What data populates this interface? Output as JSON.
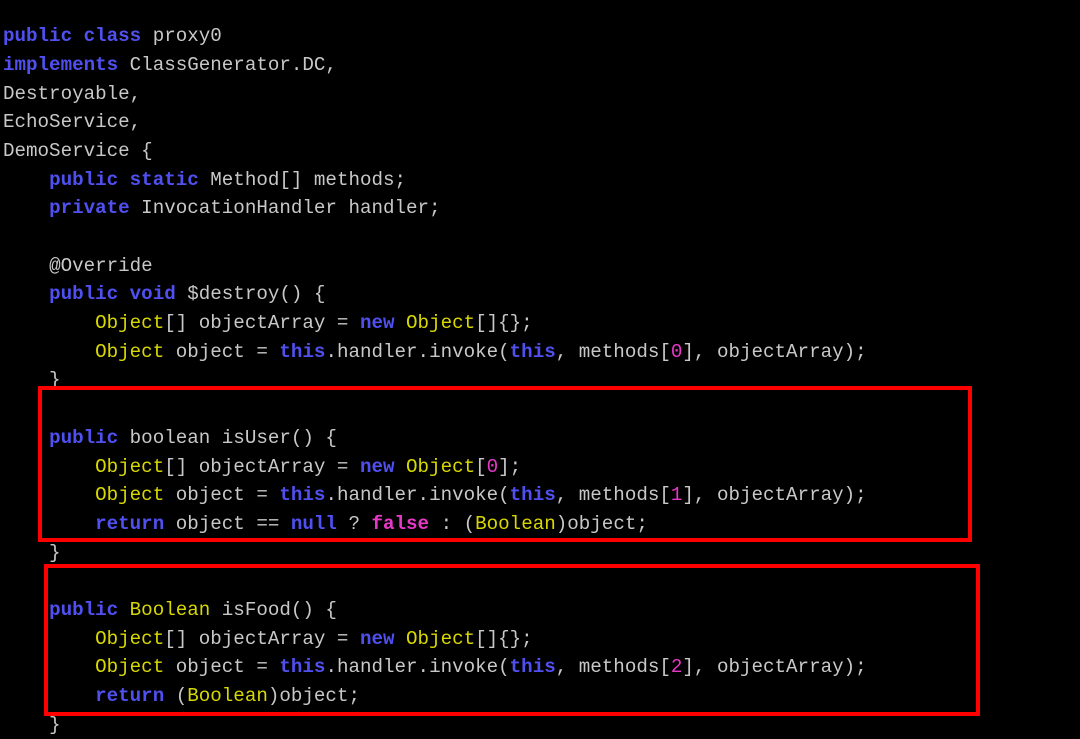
{
  "editor": {
    "language": "java",
    "background_color": "#000000",
    "default_text_color": "#c8c8c8",
    "syntax_colors": {
      "keyword": "#5050f0",
      "type": "#d8d800",
      "annotation": "#00a0a0",
      "primitive": "#44e8e8",
      "literal": "#e838c8",
      "number": "#e838c8",
      "plain": "#c8c8c8"
    }
  },
  "annotations": {
    "highlight_color": "#ff0000",
    "boxes": [
      {
        "name": "isUser-method-highlight",
        "target": "isUser"
      },
      {
        "name": "isFood-method-highlight",
        "target": "isFood"
      }
    ]
  },
  "code": {
    "lines": [
      [
        {
          "t": "public",
          "c": "keyword"
        },
        {
          "t": " ",
          "c": "plain"
        },
        {
          "t": "class",
          "c": "keyword"
        },
        {
          "t": " proxy0",
          "c": "plain"
        }
      ],
      [
        {
          "t": "implements",
          "c": "keyword"
        },
        {
          "t": " ClassGenerator.DC,",
          "c": "plain"
        }
      ],
      [
        {
          "t": "Destroyable,",
          "c": "plain"
        }
      ],
      [
        {
          "t": "EchoService,",
          "c": "plain"
        }
      ],
      [
        {
          "t": "DemoService {",
          "c": "plain"
        }
      ],
      [
        {
          "t": "    ",
          "c": "plain"
        },
        {
          "t": "public",
          "c": "keyword"
        },
        {
          "t": " ",
          "c": "plain"
        },
        {
          "t": "static",
          "c": "keyword"
        },
        {
          "t": " Method[] methods;",
          "c": "plain"
        }
      ],
      [
        {
          "t": "    ",
          "c": "plain"
        },
        {
          "t": "private",
          "c": "keyword"
        },
        {
          "t": " InvocationHandler handler;",
          "c": "plain"
        }
      ],
      [
        {
          "t": "",
          "c": "plain"
        }
      ],
      [
        {
          "t": "    ",
          "c": "plain"
        },
        {
          "t": "@Override",
          "c": "annotation"
        }
      ],
      [
        {
          "t": "    ",
          "c": "plain"
        },
        {
          "t": "public",
          "c": "keyword"
        },
        {
          "t": " ",
          "c": "plain"
        },
        {
          "t": "void",
          "c": "keyword"
        },
        {
          "t": " $destroy() {",
          "c": "plain"
        }
      ],
      [
        {
          "t": "        ",
          "c": "plain"
        },
        {
          "t": "Object",
          "c": "type"
        },
        {
          "t": "[] objectArray = ",
          "c": "plain"
        },
        {
          "t": "new",
          "c": "keyword"
        },
        {
          "t": " ",
          "c": "plain"
        },
        {
          "t": "Object",
          "c": "type"
        },
        {
          "t": "[]{};",
          "c": "plain"
        }
      ],
      [
        {
          "t": "        ",
          "c": "plain"
        },
        {
          "t": "Object",
          "c": "type"
        },
        {
          "t": " object = ",
          "c": "plain"
        },
        {
          "t": "this",
          "c": "keyword"
        },
        {
          "t": ".handler.invoke(",
          "c": "plain"
        },
        {
          "t": "this",
          "c": "keyword"
        },
        {
          "t": ", methods[",
          "c": "plain"
        },
        {
          "t": "0",
          "c": "number"
        },
        {
          "t": "], objectArray);",
          "c": "plain"
        }
      ],
      [
        {
          "t": "    }",
          "c": "plain"
        }
      ],
      [
        {
          "t": "",
          "c": "plain"
        }
      ],
      [
        {
          "t": "    ",
          "c": "plain"
        },
        {
          "t": "public",
          "c": "keyword"
        },
        {
          "t": " ",
          "c": "plain"
        },
        {
          "t": "boolean",
          "c": "primitive"
        },
        {
          "t": " isUser() {",
          "c": "plain"
        }
      ],
      [
        {
          "t": "        ",
          "c": "plain"
        },
        {
          "t": "Object",
          "c": "type"
        },
        {
          "t": "[] objectArray = ",
          "c": "plain"
        },
        {
          "t": "new",
          "c": "keyword"
        },
        {
          "t": " ",
          "c": "plain"
        },
        {
          "t": "Object",
          "c": "type"
        },
        {
          "t": "[",
          "c": "plain"
        },
        {
          "t": "0",
          "c": "number"
        },
        {
          "t": "];",
          "c": "plain"
        }
      ],
      [
        {
          "t": "        ",
          "c": "plain"
        },
        {
          "t": "Object",
          "c": "type"
        },
        {
          "t": " object = ",
          "c": "plain"
        },
        {
          "t": "this",
          "c": "keyword"
        },
        {
          "t": ".handler.invoke(",
          "c": "plain"
        },
        {
          "t": "this",
          "c": "keyword"
        },
        {
          "t": ", methods[",
          "c": "plain"
        },
        {
          "t": "1",
          "c": "number"
        },
        {
          "t": "], objectArray);",
          "c": "plain"
        }
      ],
      [
        {
          "t": "        ",
          "c": "plain"
        },
        {
          "t": "return",
          "c": "keyword"
        },
        {
          "t": " object == ",
          "c": "plain"
        },
        {
          "t": "null",
          "c": "keyword"
        },
        {
          "t": " ? ",
          "c": "plain"
        },
        {
          "t": "false",
          "c": "literal"
        },
        {
          "t": " : (",
          "c": "plain"
        },
        {
          "t": "Boolean",
          "c": "type"
        },
        {
          "t": ")object;",
          "c": "plain"
        }
      ],
      [
        {
          "t": "    }",
          "c": "plain"
        }
      ],
      [
        {
          "t": "",
          "c": "plain"
        }
      ],
      [
        {
          "t": "    ",
          "c": "plain"
        },
        {
          "t": "public",
          "c": "keyword"
        },
        {
          "t": " ",
          "c": "plain"
        },
        {
          "t": "Boolean",
          "c": "type"
        },
        {
          "t": " isFood() {",
          "c": "plain"
        }
      ],
      [
        {
          "t": "        ",
          "c": "plain"
        },
        {
          "t": "Object",
          "c": "type"
        },
        {
          "t": "[] objectArray = ",
          "c": "plain"
        },
        {
          "t": "new",
          "c": "keyword"
        },
        {
          "t": " ",
          "c": "plain"
        },
        {
          "t": "Object",
          "c": "type"
        },
        {
          "t": "[]{};",
          "c": "plain"
        }
      ],
      [
        {
          "t": "        ",
          "c": "plain"
        },
        {
          "t": "Object",
          "c": "type"
        },
        {
          "t": " object = ",
          "c": "plain"
        },
        {
          "t": "this",
          "c": "keyword"
        },
        {
          "t": ".handler.invoke(",
          "c": "plain"
        },
        {
          "t": "this",
          "c": "keyword"
        },
        {
          "t": ", methods[",
          "c": "plain"
        },
        {
          "t": "2",
          "c": "number"
        },
        {
          "t": "], objectArray);",
          "c": "plain"
        }
      ],
      [
        {
          "t": "        ",
          "c": "plain"
        },
        {
          "t": "return",
          "c": "keyword"
        },
        {
          "t": " (",
          "c": "plain"
        },
        {
          "t": "Boolean",
          "c": "type"
        },
        {
          "t": ")object;",
          "c": "plain"
        }
      ],
      [
        {
          "t": "    }",
          "c": "plain"
        }
      ]
    ]
  }
}
